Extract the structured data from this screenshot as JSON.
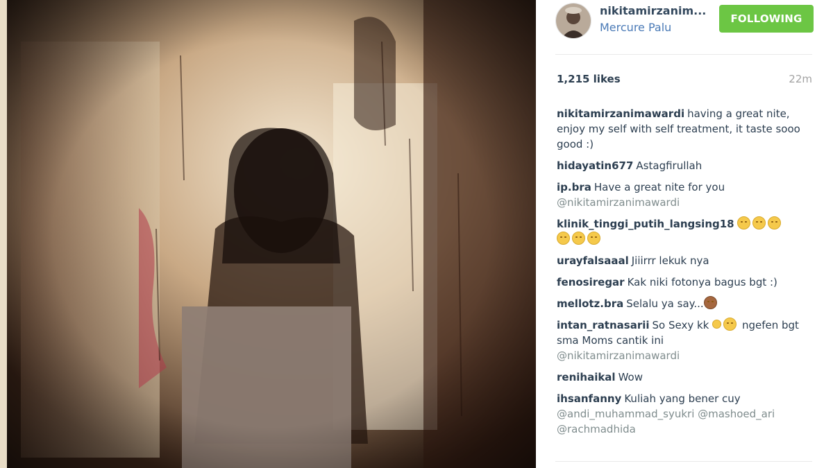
{
  "post": {
    "username": "nikitamirzanim...",
    "location": "Mercure Palu",
    "follow_label": "FOLLOWING",
    "likes": "1,215 likes",
    "time": "22m"
  },
  "comments": [
    {
      "user": "nikitamirzanimawardi",
      "text": "having a great nite, enjoy my self with self treatment, it taste sooo good :)"
    },
    {
      "user": "hidayatin677",
      "text": "Astagfirullah"
    },
    {
      "user": "ip.bra",
      "text": "Have a great nite for you",
      "mention": "@nikitamirzanimawardi"
    },
    {
      "user": "klinik_tinggi_putih_langsing18",
      "text": ""
    },
    {
      "user": "urayfalsaaal",
      "text": "Jiiirrr lekuk nya"
    },
    {
      "user": "fenosiregar",
      "text": "Kak niki fotonya bagus bgt :)"
    },
    {
      "user": "mellotz.bra",
      "text": "Selalu ya say..."
    },
    {
      "user": "intan_ratnasarii",
      "text": "So Sexy kk",
      "text2": "ngefen bgt sma Moms cantik ini",
      "mention": "@nikitamirzanimawardi"
    },
    {
      "user": "renihaikal",
      "text": "Wow"
    },
    {
      "user": "ihsanfanny",
      "text": "Kuliah yang bener cuy",
      "mention": "@andi_muhammad_syukri @mashoed_ari @rachmadhida"
    }
  ],
  "icons": {
    "avatar": "profile-avatar",
    "emoji_sad": "crying-face-emoji",
    "emoji_monkey": "see-no-evil-monkey-emoji",
    "emoji_smile": "smiling-face-emoji"
  },
  "colors": {
    "follow_button": "#6cc644",
    "username": "#34495e",
    "location": "#4a7ab6"
  }
}
